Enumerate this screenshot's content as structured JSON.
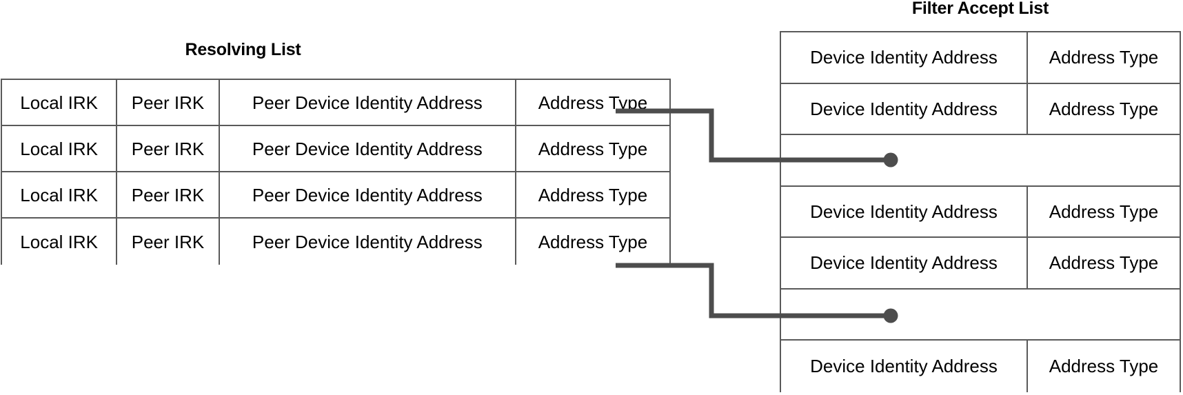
{
  "diagram": {
    "resolving_list": {
      "title": "Resolving List",
      "columns": [
        "Local IRK",
        "Peer IRK",
        "Peer Device Identity Address",
        "Address Type"
      ],
      "rows": [
        [
          "Local IRK",
          "Peer IRK",
          "Peer Device Identity Address",
          "Address Type"
        ],
        [
          "Local IRK",
          "Peer IRK",
          "Peer Device Identity Address",
          "Address Type"
        ],
        [
          "Local IRK",
          "Peer IRK",
          "Peer Device Identity Address",
          "Address Type"
        ],
        [
          "Local IRK",
          "Peer IRK",
          "Peer Device Identity Address",
          "Address Type"
        ]
      ]
    },
    "filter_accept_list": {
      "title": "Filter Accept List",
      "columns": [
        "Device Identity Address",
        "Address Type"
      ],
      "rows": [
        {
          "empty": false,
          "cells": [
            "Device Identity Address",
            "Address Type"
          ]
        },
        {
          "empty": false,
          "cells": [
            "Device Identity Address",
            "Address Type"
          ]
        },
        {
          "empty": true,
          "cells": [
            "",
            ""
          ]
        },
        {
          "empty": false,
          "cells": [
            "Device Identity Address",
            "Address Type"
          ]
        },
        {
          "empty": false,
          "cells": [
            "Device Identity Address",
            "Address Type"
          ]
        },
        {
          "empty": true,
          "cells": [
            "",
            ""
          ]
        },
        {
          "empty": false,
          "cells": [
            "Device Identity Address",
            "Address Type"
          ]
        }
      ]
    },
    "connectors": [
      {
        "name": "connector-row1-to-fal-row3",
        "from_row": 1,
        "to_row": 3
      },
      {
        "name": "connector-row4-to-fal-row6",
        "from_row": 4,
        "to_row": 6
      }
    ],
    "colors": {
      "border": "#595959",
      "connector": "#4d4d4d",
      "text": "#000000",
      "background": "#ffffff"
    }
  }
}
